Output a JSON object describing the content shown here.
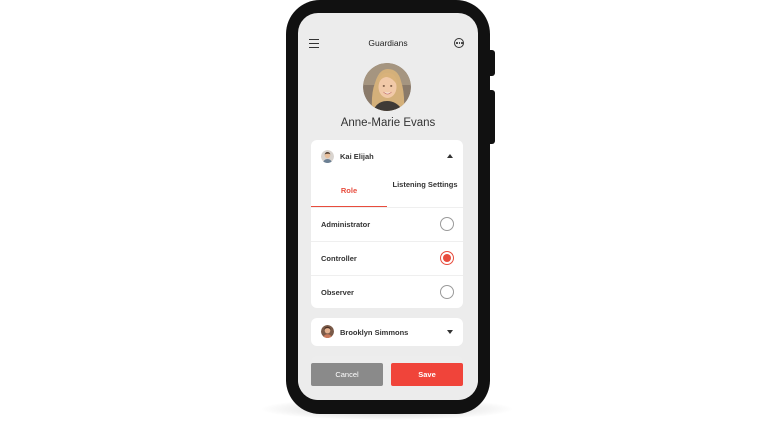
{
  "header": {
    "title": "Guardians",
    "menu_icon": "hamburger-menu-icon",
    "more_icon": "more-options-icon"
  },
  "profile": {
    "name": "Anne-Marie Evans"
  },
  "guardians": [
    {
      "name": "Kai Elijah",
      "expanded": true,
      "tabs": [
        {
          "label": "Role",
          "active": true
        },
        {
          "label": "Listening Settings",
          "active": false
        }
      ],
      "roles": [
        {
          "label": "Administrator",
          "selected": false
        },
        {
          "label": "Controller",
          "selected": true
        },
        {
          "label": "Observer",
          "selected": false
        }
      ]
    },
    {
      "name": "Brooklyn Simmons",
      "expanded": false
    }
  ],
  "actions": {
    "cancel_label": "Cancel",
    "save_label": "Save"
  },
  "colors": {
    "accent": "#e84c3d",
    "save_button": "#f0443a",
    "cancel_button": "#8a8a8a",
    "screen_bg": "#ececec",
    "phone_frame": "#111111"
  }
}
